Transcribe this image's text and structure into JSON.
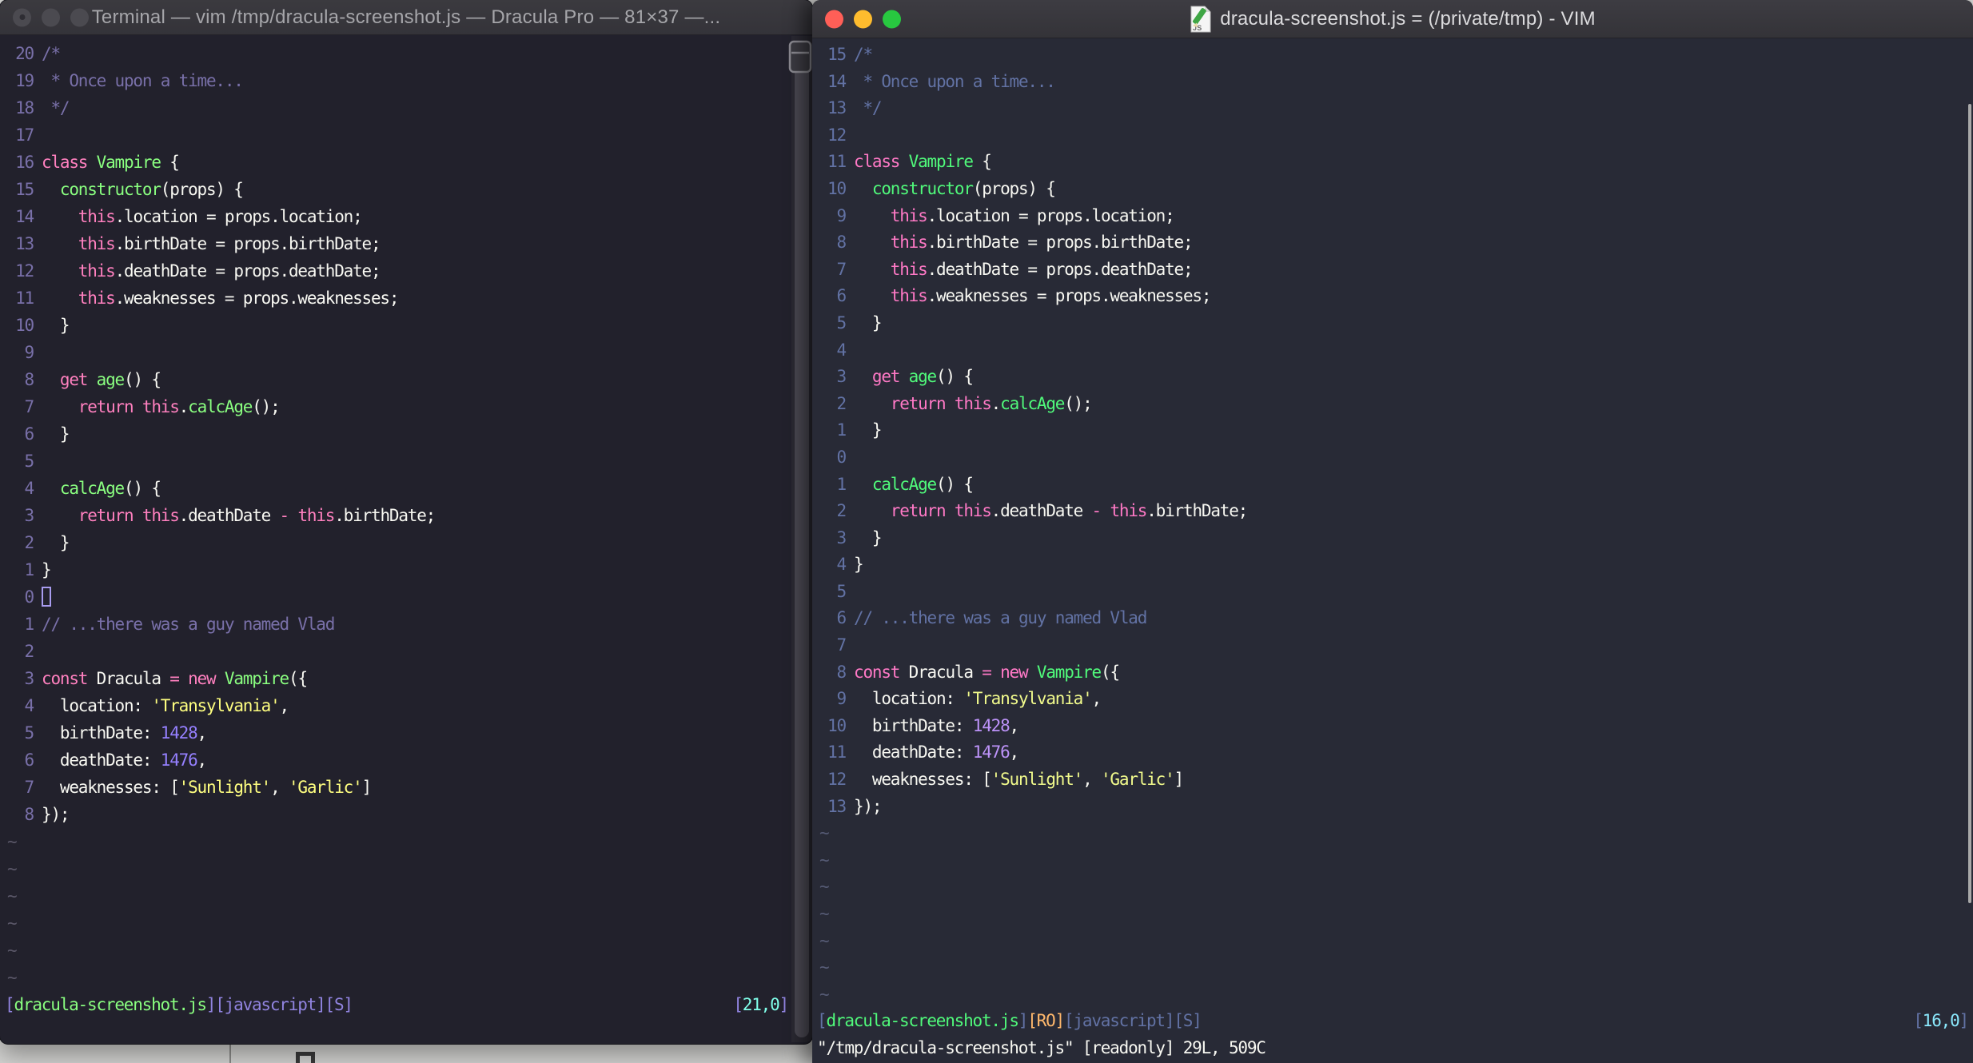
{
  "left_window": {
    "title": "Terminal — vim /tmp/dracula-screenshot.js — Dracula Pro — 81×37 —...",
    "theme_name_shown_in_title": "Dracula Pro",
    "terminal_size_shown_in_title": "81×37",
    "traffic_lights": {
      "close": "#4B4A50",
      "minimize": "#4B4A50",
      "zoom": "#4B4A50",
      "close_dot": "#2E2D33"
    },
    "cursor": {
      "line": 21,
      "col": 0,
      "style": "hollow",
      "color": "#A89CEF"
    },
    "palette": {
      "bg": "#22212C",
      "fg": "#F8F8F2",
      "cm": "#7970A9",
      "ln": "#7970A9",
      "pk": "#FF80BF",
      "gr": "#8AFF80",
      "yl": "#FFFF80",
      "pu": "#9580FF",
      "cy": "#80FFEA",
      "sb": "#9184E0",
      "or": "#FFCA80",
      "tilde": "#5A5768"
    },
    "status_left": [
      [
        "sb",
        "["
      ],
      [
        "gr",
        "dracula-screenshot.js"
      ],
      [
        "sb",
        "][javascript][S]"
      ]
    ],
    "status_right": [
      [
        "sb",
        "["
      ],
      [
        "cy",
        "21,0"
      ],
      [
        "sb",
        "]"
      ]
    ],
    "command_line": "",
    "tilde_char": "~",
    "tilde_count": 6
  },
  "right_window": {
    "title": "dracula-screenshot.js = (/private/tmp) - VIM",
    "doc_icon": "js-document-icon",
    "traffic_lights": {
      "close": "#FF5F57",
      "minimize": "#FEBC2E",
      "zoom": "#28C840"
    },
    "cursor": {
      "line": 16,
      "col": 0,
      "style": "none"
    },
    "palette": {
      "bg": "#282A36",
      "fg": "#F8F8F2",
      "cm": "#6272A4",
      "ln": "#6272A4",
      "pk": "#FF79C6",
      "gr": "#50FA7B",
      "yl": "#F1FA8C",
      "pu": "#BD93F9",
      "cy": "#8BE9FD",
      "sb": "#6272A4",
      "or": "#FFB86C",
      "tilde": "#565B75"
    },
    "status_left": [
      [
        "sb",
        "["
      ],
      [
        "gr",
        "dracula-screenshot.js"
      ],
      [
        "sb",
        "]"
      ],
      [
        "or",
        "[RO]"
      ],
      [
        "sb",
        "[javascript][S]"
      ]
    ],
    "status_right": [
      [
        "sb",
        "["
      ],
      [
        "cy",
        "16,0"
      ],
      [
        "sb",
        "]"
      ]
    ],
    "command_line": "\"/tmp/dracula-screenshot.js\" [readonly] 29L, 509C",
    "tilde_char": "~",
    "tilde_count": 7
  },
  "code_lines": [
    [
      [
        "cm",
        "/*"
      ]
    ],
    [
      [
        "cm",
        " * Once upon a time..."
      ]
    ],
    [
      [
        "cm",
        " */"
      ]
    ],
    [],
    [
      [
        "pk",
        "class "
      ],
      [
        "gr",
        "Vampire "
      ],
      [
        "fg",
        "{"
      ]
    ],
    [
      [
        "fg",
        "  "
      ],
      [
        "gr",
        "constructor"
      ],
      [
        "fg",
        "(props) {"
      ]
    ],
    [
      [
        "fg",
        "    "
      ],
      [
        "pk",
        "this"
      ],
      [
        "fg",
        ".location = props.location;"
      ]
    ],
    [
      [
        "fg",
        "    "
      ],
      [
        "pk",
        "this"
      ],
      [
        "fg",
        ".birthDate = props.birthDate;"
      ]
    ],
    [
      [
        "fg",
        "    "
      ],
      [
        "pk",
        "this"
      ],
      [
        "fg",
        ".deathDate = props.deathDate;"
      ]
    ],
    [
      [
        "fg",
        "    "
      ],
      [
        "pk",
        "this"
      ],
      [
        "fg",
        ".weaknesses = props.weaknesses;"
      ]
    ],
    [
      [
        "fg",
        "  }"
      ]
    ],
    [],
    [
      [
        "fg",
        "  "
      ],
      [
        "pk",
        "get "
      ],
      [
        "gr",
        "age"
      ],
      [
        "fg",
        "() {"
      ]
    ],
    [
      [
        "fg",
        "    "
      ],
      [
        "pk",
        "return "
      ],
      [
        "pk",
        "this"
      ],
      [
        "fg",
        "."
      ],
      [
        "gr",
        "calcAge"
      ],
      [
        "fg",
        "();"
      ]
    ],
    [
      [
        "fg",
        "  }"
      ]
    ],
    [],
    [
      [
        "fg",
        "  "
      ],
      [
        "gr",
        "calcAge"
      ],
      [
        "fg",
        "() {"
      ]
    ],
    [
      [
        "fg",
        "    "
      ],
      [
        "pk",
        "return "
      ],
      [
        "pk",
        "this"
      ],
      [
        "fg",
        ".deathDate "
      ],
      [
        "pk",
        "-"
      ],
      [
        "fg",
        " "
      ],
      [
        "pk",
        "this"
      ],
      [
        "fg",
        ".birthDate;"
      ]
    ],
    [
      [
        "fg",
        "  }"
      ]
    ],
    [
      [
        "fg",
        "}"
      ]
    ],
    [],
    [
      [
        "cm",
        "// ...there was a guy named Vlad"
      ]
    ],
    [],
    [
      [
        "pk",
        "const "
      ],
      [
        "fg",
        "Dracula "
      ],
      [
        "pk",
        "= new "
      ],
      [
        "gr",
        "Vampire"
      ],
      [
        "fg",
        "({"
      ]
    ],
    [
      [
        "fg",
        "  location: "
      ],
      [
        "yl",
        "'Transylvania'"
      ],
      [
        "fg",
        ","
      ]
    ],
    [
      [
        "fg",
        "  birthDate: "
      ],
      [
        "pu",
        "1428"
      ],
      [
        "fg",
        ","
      ]
    ],
    [
      [
        "fg",
        "  deathDate: "
      ],
      [
        "pu",
        "1476"
      ],
      [
        "fg",
        ","
      ]
    ],
    [
      [
        "fg",
        "  weaknesses: ["
      ],
      [
        "yl",
        "'Sunlight'"
      ],
      [
        "fg",
        ", "
      ],
      [
        "yl",
        "'Garlic'"
      ],
      [
        "fg",
        "]"
      ]
    ],
    [
      [
        "fg",
        "});"
      ]
    ]
  ],
  "desktop": {
    "strip_color": "#D4D4D2",
    "divider_line_color": "#8C8C8A"
  }
}
